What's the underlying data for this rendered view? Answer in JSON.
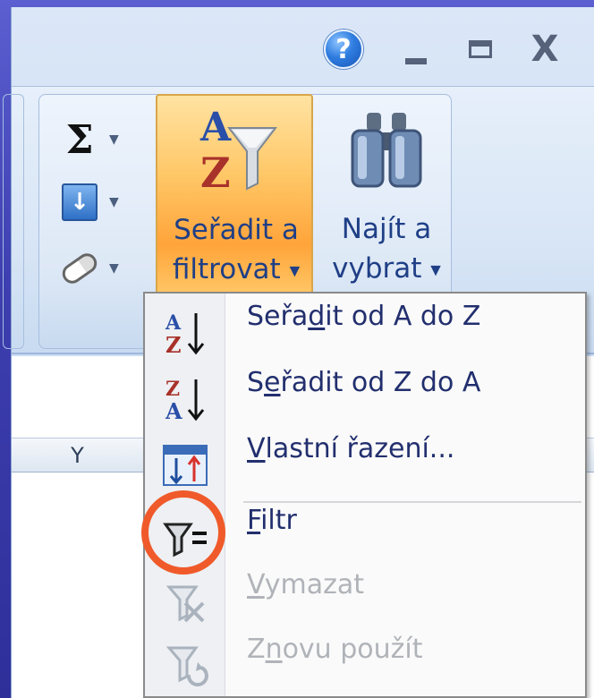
{
  "window": {
    "controls": {
      "help": "?",
      "close": "X"
    }
  },
  "ribbon": {
    "editing": {
      "autosum_icon": "sigma-icon",
      "autosum_symbol": "Σ",
      "fill_icon": "fill-down-icon",
      "clear_icon": "eraser-icon",
      "sort_filter": {
        "line1": "Seřadit a",
        "line2": "filtrovat",
        "icon": "sort-filter-icon"
      },
      "find_select": {
        "line1": "Najít a",
        "line2": "vybrat",
        "icon": "binoculars-icon"
      }
    }
  },
  "sheet": {
    "column_header": "Y"
  },
  "menu": {
    "items": [
      {
        "pre": "Seřa",
        "underline": "d",
        "post": "it od A do Z",
        "icon": "sort-a-to-z-icon",
        "enabled": true
      },
      {
        "pre": "S",
        "underline": "e",
        "post": "řadit od Z do A",
        "icon": "sort-z-to-a-icon",
        "enabled": true
      },
      {
        "pre": "",
        "underline": "V",
        "post": "lastní řazení...",
        "icon": "custom-sort-icon",
        "enabled": true
      },
      {
        "pre": "",
        "underline": "F",
        "post": "iltr",
        "icon": "filter-icon",
        "enabled": true
      },
      {
        "pre": "",
        "underline": "V",
        "post": "ymazat",
        "icon": "clear-filter-icon",
        "enabled": false
      },
      {
        "pre": "Z",
        "underline": "n",
        "post": "ovu použít",
        "icon": "reapply-filter-icon",
        "enabled": false
      }
    ]
  },
  "colors": {
    "highlight": "#f05a2a",
    "menu_text": "#222f6e",
    "disabled_text": "#b0b3b8",
    "active_button": "#ffc767"
  }
}
